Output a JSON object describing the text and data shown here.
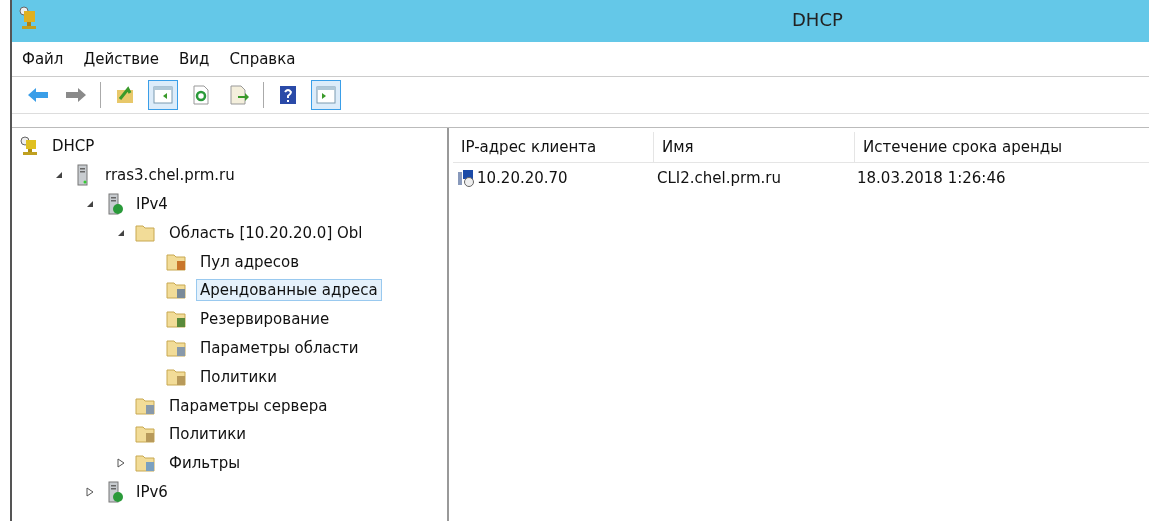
{
  "window": {
    "title": "DHCP"
  },
  "menu": [
    "Файл",
    "Действие",
    "Вид",
    "Справка"
  ],
  "toolbar": [
    {
      "kind": "back",
      "pressed": false
    },
    {
      "kind": "forward",
      "pressed": false
    },
    {
      "kind": "separator"
    },
    {
      "kind": "up",
      "pressed": false
    },
    {
      "kind": "tree-pane",
      "pressed": true
    },
    {
      "kind": "refresh",
      "pressed": false
    },
    {
      "kind": "export",
      "pressed": false
    },
    {
      "kind": "separator"
    },
    {
      "kind": "help",
      "pressed": false
    },
    {
      "kind": "action-pane",
      "pressed": true
    }
  ],
  "tree": [
    {
      "label": "DHCP",
      "kind": "dhcp",
      "selected": false,
      "children": [
        {
          "label": "rras3.chel.prm.ru",
          "kind": "server",
          "selected": false,
          "expanded": true,
          "children": [
            {
              "label": "IPv4",
              "kind": "ip",
              "selected": false,
              "expanded": true,
              "children": [
                {
                  "label": "Область [10.20.20.0] Obl",
                  "kind": "folder",
                  "selected": false,
                  "expanded": true,
                  "children": [
                    {
                      "label": "Пул адресов",
                      "kind": "pool",
                      "selected": false
                    },
                    {
                      "label": "Арендованные адреса",
                      "kind": "leases",
                      "selected": true
                    },
                    {
                      "label": "Резервирование",
                      "kind": "reserve",
                      "selected": false
                    },
                    {
                      "label": "Параметры области",
                      "kind": "options",
                      "selected": false
                    },
                    {
                      "label": "Политики",
                      "kind": "policy",
                      "selected": false
                    }
                  ]
                },
                {
                  "label": "Параметры сервера",
                  "kind": "options",
                  "selected": false
                },
                {
                  "label": "Политики",
                  "kind": "policy",
                  "selected": false
                },
                {
                  "label": "Фильтры",
                  "kind": "filter",
                  "selected": false,
                  "expanded": false
                }
              ]
            },
            {
              "label": "IPv6",
              "kind": "ip",
              "selected": false,
              "expanded": false
            }
          ]
        }
      ]
    }
  ],
  "table": {
    "columns": [
      "IP-адрес клиента",
      "Имя",
      "Истечение срока аренды"
    ],
    "rows": [
      {
        "cells": [
          "10.20.20.70",
          "CLI2.chel.prm.ru",
          "18.03.2018 1:26:46"
        ]
      }
    ]
  }
}
